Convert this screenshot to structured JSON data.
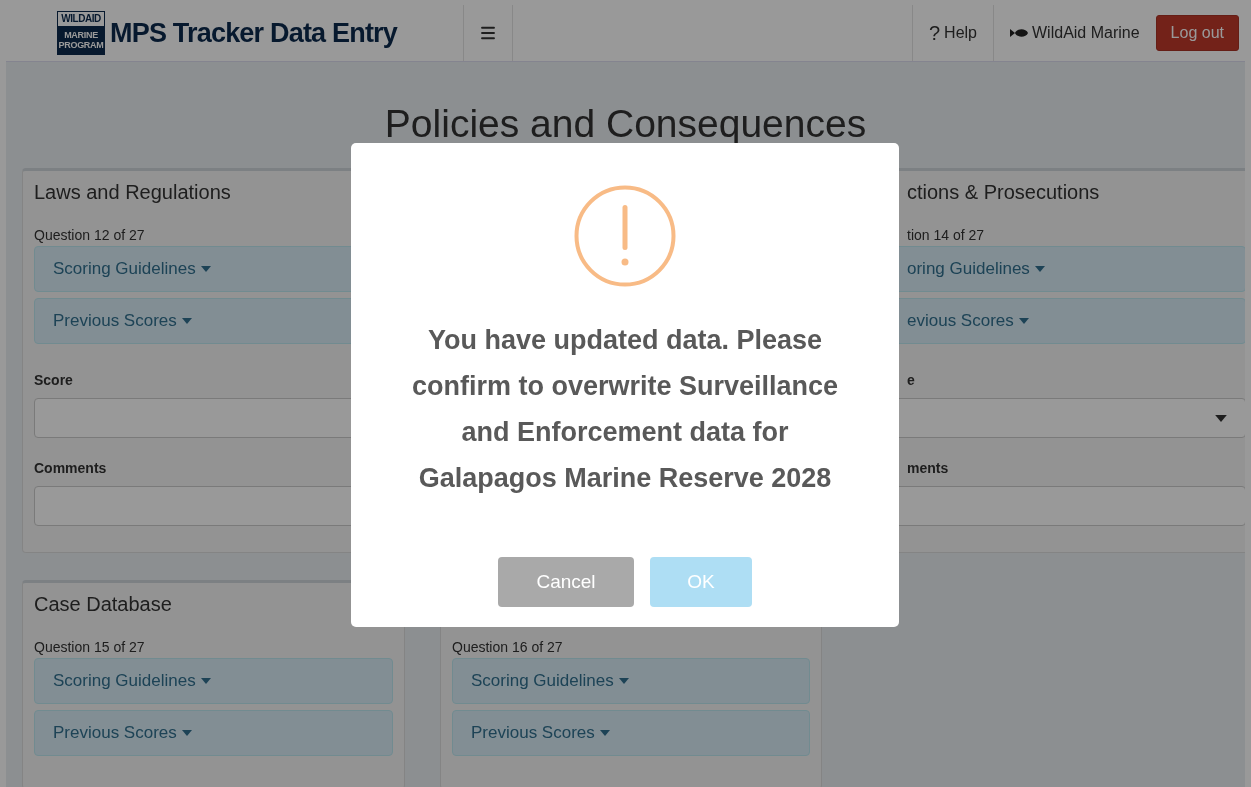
{
  "header": {
    "logo": [
      "WILDAID",
      "MARINE",
      "PROGRAM"
    ],
    "title": "MPS Tracker Data Entry",
    "help_mark": "?",
    "help": "Help",
    "user": "WildAid Marine",
    "logout": "Log out"
  },
  "page_title": "Policies and Consequences",
  "top_cards": [
    {
      "title": "Laws and Regulations",
      "question": "Question 12 of 27",
      "guidelines": "Scoring Guidelines",
      "previous": "Previous Scores",
      "score_label": "Score",
      "comments_label": "Comments"
    },
    {
      "title": "ctions & Prosecutions",
      "question": "tion 14 of 27",
      "guidelines": "oring Guidelines",
      "previous": "evious Scores",
      "score_label": "e",
      "comments_label": "ments"
    }
  ],
  "bottom_cards": [
    {
      "title": "Case Database",
      "question": "Question 15 of 27",
      "guidelines": "Scoring Guidelines",
      "previous": "Previous Scores"
    },
    {
      "question": "Question 16 of 27",
      "guidelines": "Scoring Guidelines",
      "previous": "Previous Scores"
    }
  ],
  "dialog": {
    "message": "You have updated data. Please confirm to overwrite Surveillance and Enforcement data for Galapagos Marine Reserve 2028",
    "buttons": [
      {
        "label": "Cancel",
        "kind": "cancel"
      },
      {
        "label": "OK",
        "kind": "confirm"
      }
    ]
  }
}
